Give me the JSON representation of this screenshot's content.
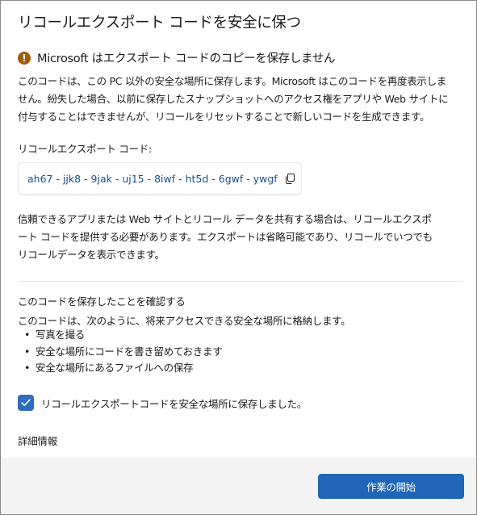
{
  "dialog": {
    "title": "リコールエクスポート コードを安全に保つ"
  },
  "warning": {
    "icon": "warning-icon",
    "text": "Microsoft はエクスポート コードのコピーを保存しません"
  },
  "intro": {
    "text": "このコードは、この PC 以外の安全な場所に保存します。Microsoft はこのコードを再度表示しません。紛失した場合、以前に保存したスナップショットへのアクセス権をアプリや Web サイトに付与することはできませんが、リコールをリセットすることで新しいコードを生成できます。"
  },
  "code": {
    "label": "リコールエクスポート コード:",
    "value": "ah67 - jjk8 - 9jak - uj15 - 8iwf - ht5d - 6gwf - ywgf",
    "copy_icon": "copy-icon"
  },
  "sharing": {
    "text": "信頼できるアプリまたは Web サイトとリコール データを共有する場合は、リコールエクスポート コードを提供する必要があります。エクスポートは省略可能であり、リコールでいつでもリコールデータを表示できます。"
  },
  "confirm": {
    "heading": "このコードを保存したことを確認する",
    "description": "このコードは、次のように、将来アクセスできる安全な場所に格納します。",
    "bullets": [
      "写真を撮る",
      "安全な場所にコードを書き留めておきます",
      "安全な場所にあるファイルへの保存"
    ],
    "checkbox_label": "リコールエクスポートコードを安全な場所に保存しました。",
    "checked": true
  },
  "more_info": "詳細情報",
  "footer": {
    "primary_button": "作業の開始"
  },
  "colors": {
    "accent": "#1f66b8",
    "checkbox": "#2f6cbc",
    "code_text": "#1a4f8f",
    "warning": "#9d5d00",
    "footer_bg": "#f3f3f3"
  }
}
